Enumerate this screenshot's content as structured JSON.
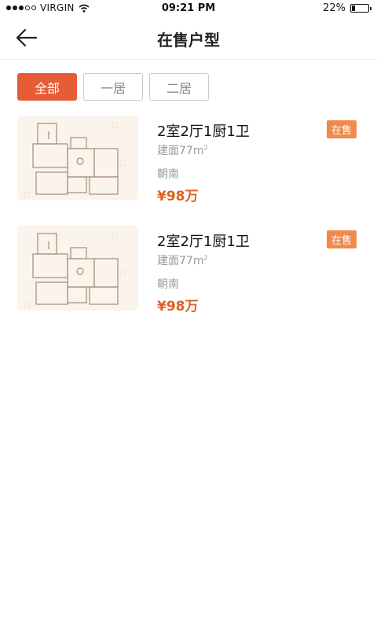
{
  "status_bar": {
    "carrier": "VIRGIN",
    "time": "09:21 PM",
    "battery": "22%",
    "battery_level": 0.22
  },
  "nav": {
    "title": "在售户型",
    "back_icon": "arrow-left-icon"
  },
  "filters": [
    {
      "label": "全部",
      "active": true
    },
    {
      "label": "一居",
      "active": false
    },
    {
      "label": "二居",
      "active": false
    }
  ],
  "listings": [
    {
      "title": "2室2厅1厨1卫",
      "status": "在售",
      "area_label": "建面77m",
      "area_sup": "2",
      "orientation": "朝南",
      "price": "¥98万"
    },
    {
      "title": "2室2厅1厨1卫",
      "status": "在售",
      "area_label": "建面77m",
      "area_sup": "2",
      "orientation": "朝南",
      "price": "¥98万"
    }
  ],
  "colors": {
    "accent": "#e65c36",
    "tag": "#f08a4c",
    "price": "#e0601f"
  }
}
